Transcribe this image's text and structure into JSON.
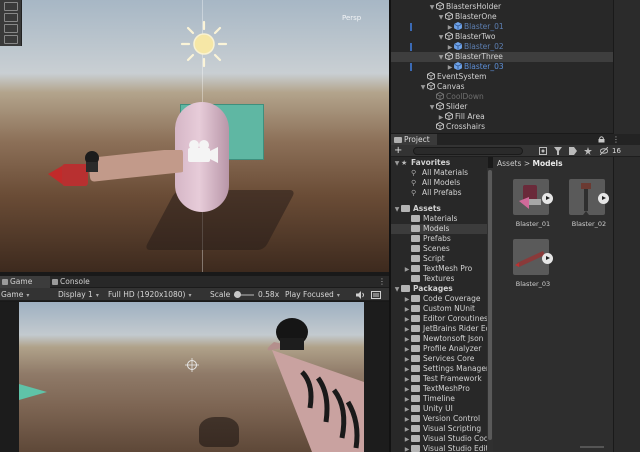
{
  "scene": {
    "persp_label": "Persp"
  },
  "game": {
    "tabs": [
      {
        "label": "Game"
      },
      {
        "label": "Console"
      }
    ],
    "toolbar": {
      "mode": "Game",
      "display": "Display 1",
      "resolution": "Full HD (1920x1080)",
      "scale_label": "Scale",
      "scale_value": "0.58x",
      "play_mode": "Play Focused"
    }
  },
  "hierarchy": {
    "rows": [
      {
        "label": "BlastersHolder",
        "indent": 1,
        "arrow": "▼",
        "style": "normal",
        "cube": "go"
      },
      {
        "label": "BlasterOne",
        "indent": 2,
        "arrow": "▼",
        "style": "normal",
        "cube": "go"
      },
      {
        "label": "Blaster_01",
        "indent": 3,
        "arrow": "▶",
        "style": "dim",
        "cube": "prefab"
      },
      {
        "label": "BlasterTwo",
        "indent": 2,
        "arrow": "▼",
        "style": "normal",
        "cube": "go"
      },
      {
        "label": "Blaster_02",
        "indent": 3,
        "arrow": "▶",
        "style": "dim",
        "cube": "prefab"
      },
      {
        "label": "BlasterThree",
        "indent": 2,
        "arrow": "▼",
        "style": "sel",
        "cube": "go"
      },
      {
        "label": "Blaster_03",
        "indent": 3,
        "arrow": "▶",
        "style": "prefab",
        "cube": "prefab"
      },
      {
        "label": "EventSystem",
        "indent": 0,
        "arrow": "",
        "style": "normal",
        "cube": "go"
      },
      {
        "label": "Canvas",
        "indent": 0,
        "arrow": "▼",
        "style": "normal",
        "cube": "go"
      },
      {
        "label": "CoolDown",
        "indent": 1,
        "arrow": "",
        "style": "gray",
        "cube": "go"
      },
      {
        "label": "Slider",
        "indent": 1,
        "arrow": "▼",
        "style": "normal",
        "cube": "go"
      },
      {
        "label": "Fill Area",
        "indent": 2,
        "arrow": "▶",
        "style": "normal",
        "cube": "go"
      },
      {
        "label": "Crosshairs",
        "indent": 1,
        "arrow": "",
        "style": "normal",
        "cube": "go"
      }
    ]
  },
  "project": {
    "tab_label": "Project",
    "add_label": "+",
    "hidden_count": "16",
    "tree": [
      {
        "label": "Favorites",
        "type": "header",
        "arrow": "▼",
        "icon": "star"
      },
      {
        "label": "All Materials",
        "type": "search",
        "arrow": "",
        "icon": "search"
      },
      {
        "label": "All Models",
        "type": "search",
        "arrow": "",
        "icon": "search"
      },
      {
        "label": "All Prefabs",
        "type": "search",
        "arrow": "",
        "icon": "search"
      },
      {
        "label": "",
        "type": "spacer",
        "arrow": "",
        "icon": ""
      },
      {
        "label": "Assets",
        "type": "header",
        "arrow": "▼",
        "icon": "folder"
      },
      {
        "label": "Materials",
        "type": "folder",
        "arrow": "",
        "icon": "folder"
      },
      {
        "label": "Models",
        "type": "folder-sel",
        "arrow": "",
        "icon": "folder"
      },
      {
        "label": "Prefabs",
        "type": "folder",
        "arrow": "",
        "icon": "folder"
      },
      {
        "label": "Scenes",
        "type": "folder",
        "arrow": "",
        "icon": "folder"
      },
      {
        "label": "Script",
        "type": "folder",
        "arrow": "",
        "icon": "folder"
      },
      {
        "label": "TextMesh Pro",
        "type": "folder",
        "arrow": "▶",
        "icon": "folder"
      },
      {
        "label": "Textures",
        "type": "folder",
        "arrow": "",
        "icon": "folder"
      },
      {
        "label": "Packages",
        "type": "header",
        "arrow": "▼",
        "icon": "folder"
      },
      {
        "label": "Code Coverage",
        "type": "folder",
        "arrow": "▶",
        "icon": "folder"
      },
      {
        "label": "Custom NUnit",
        "type": "folder",
        "arrow": "▶",
        "icon": "folder"
      },
      {
        "label": "Editor Coroutines",
        "type": "folder",
        "arrow": "▶",
        "icon": "folder"
      },
      {
        "label": "JetBrains Rider Edi",
        "type": "folder",
        "arrow": "▶",
        "icon": "folder"
      },
      {
        "label": "Newtonsoft Json",
        "type": "folder",
        "arrow": "▶",
        "icon": "folder"
      },
      {
        "label": "Profile Analyzer",
        "type": "folder",
        "arrow": "▶",
        "icon": "folder"
      },
      {
        "label": "Services Core",
        "type": "folder",
        "arrow": "▶",
        "icon": "folder"
      },
      {
        "label": "Settings Manager",
        "type": "folder",
        "arrow": "▶",
        "icon": "folder"
      },
      {
        "label": "Test Framework",
        "type": "folder",
        "arrow": "▶",
        "icon": "folder"
      },
      {
        "label": "TextMeshPro",
        "type": "folder",
        "arrow": "▶",
        "icon": "folder"
      },
      {
        "label": "Timeline",
        "type": "folder",
        "arrow": "▶",
        "icon": "folder"
      },
      {
        "label": "Unity UI",
        "type": "folder",
        "arrow": "▶",
        "icon": "folder"
      },
      {
        "label": "Version Control",
        "type": "folder",
        "arrow": "▶",
        "icon": "folder"
      },
      {
        "label": "Visual Scripting",
        "type": "folder",
        "arrow": "▶",
        "icon": "folder"
      },
      {
        "label": "Visual Studio Code",
        "type": "folder",
        "arrow": "▶",
        "icon": "folder"
      },
      {
        "label": "Visual Studio Edito",
        "type": "folder",
        "arrow": "▶",
        "icon": "folder"
      }
    ],
    "breadcrumb": [
      "Assets",
      "Models"
    ],
    "assets": [
      {
        "name": "Blaster_01"
      },
      {
        "name": "Blaster_02"
      },
      {
        "name": "Blaster_03"
      }
    ]
  },
  "colors": {
    "selection_blue": "#3b6ab4",
    "prefab_text": "#5d8fd8",
    "panel_bg": "#282828",
    "teal_cube": "#5fb7a3",
    "capsule_pink": "#e0c4d2",
    "crayon_red": "#b52a2a"
  }
}
